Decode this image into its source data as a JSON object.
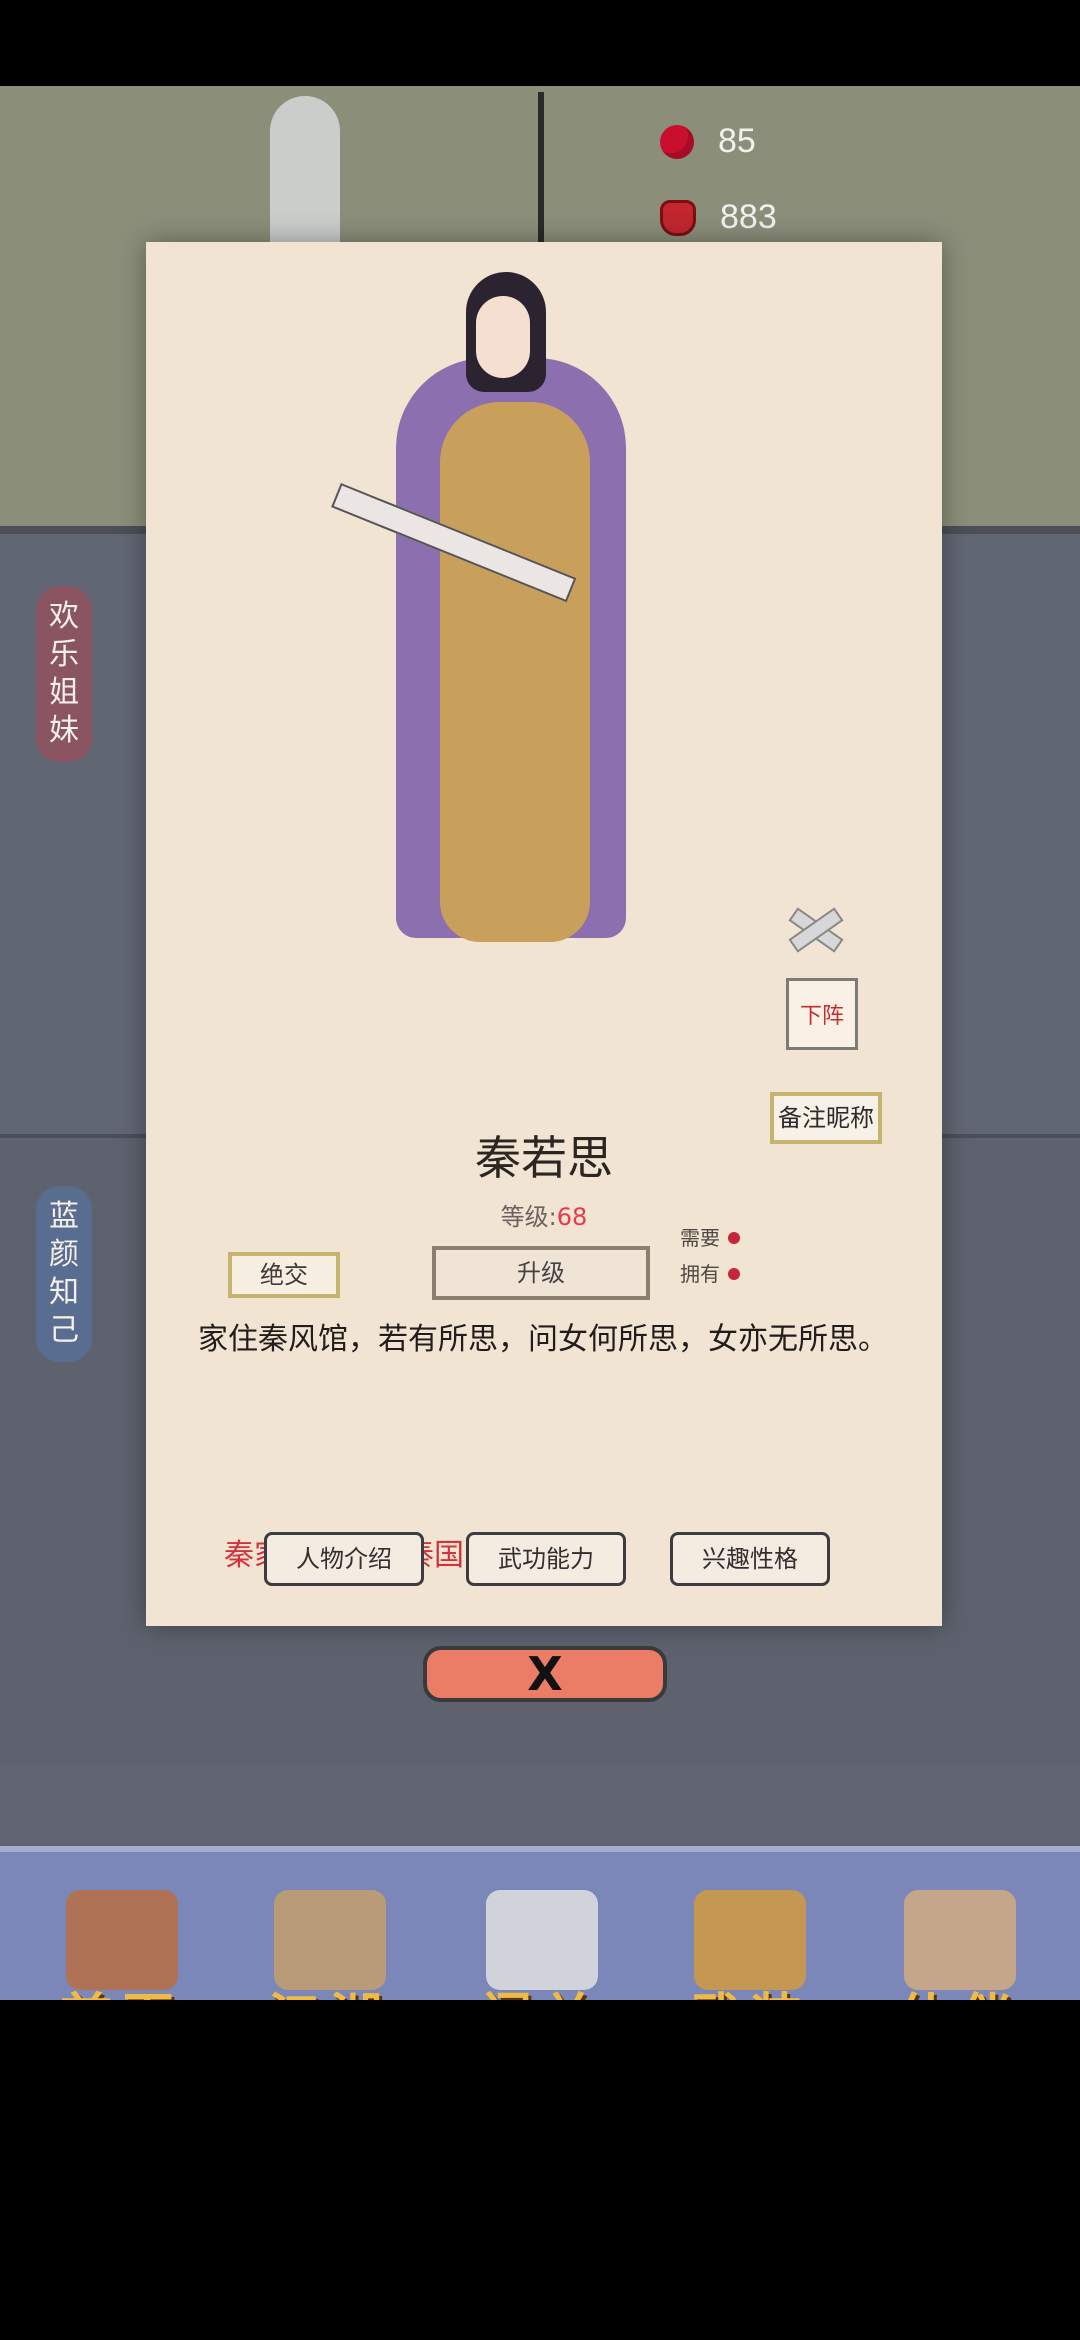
{
  "resources": {
    "rose_count": "85",
    "jar_count": "883"
  },
  "side_tabs": {
    "top": "欢乐姐妹",
    "bottom": "蓝颜知己"
  },
  "character": {
    "name": "秦若思",
    "level_label": "等级:",
    "level_value": "68",
    "need_label": "需要",
    "own_label": "拥有",
    "description": "家住秦风馆，若有所思，问女何所思，女亦无所思。",
    "quote": "秦家，不，是秦国，不能忘记。"
  },
  "dialog_buttons": {
    "break": "绝交",
    "upgrade": "升级",
    "dismiss": "下阵",
    "note_nickname": "备注昵称",
    "tab_intro": "人物介绍",
    "tab_skill": "武功能力",
    "tab_interest": "兴趣性格",
    "close": "X"
  },
  "nav": {
    "home": "首页",
    "world": "江湖",
    "battle": "闯关",
    "equip": "武装",
    "partner": "伙伴"
  }
}
